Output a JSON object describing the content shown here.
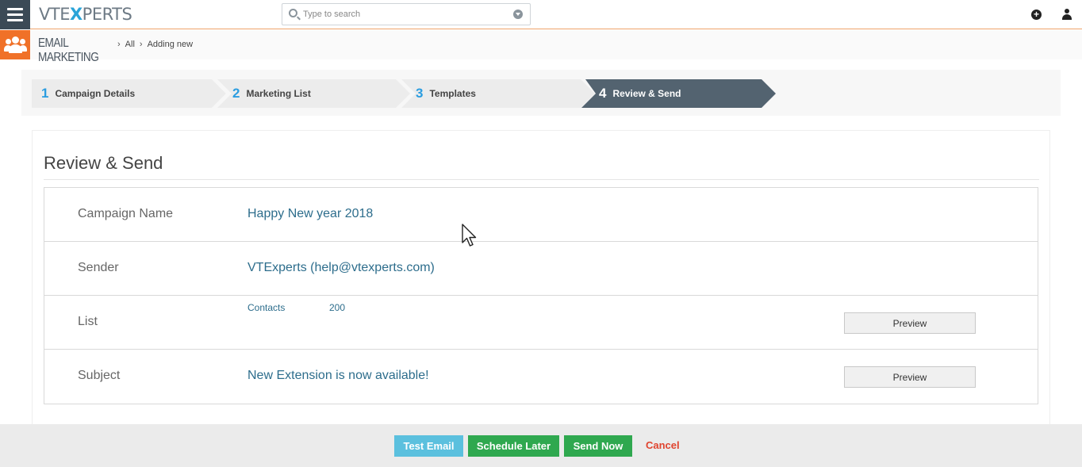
{
  "header": {
    "logo_prefix": "VTE",
    "logo_x": "X",
    "logo_suffix": "PERTS",
    "search_placeholder": "Type to search"
  },
  "breadcrumb": {
    "module": "EMAIL MARKETING",
    "items": [
      "All",
      "Adding new"
    ]
  },
  "steps": [
    {
      "num": "1",
      "label": "Campaign Details",
      "active": false
    },
    {
      "num": "2",
      "label": "Marketing List",
      "active": false
    },
    {
      "num": "3",
      "label": "Templates",
      "active": false
    },
    {
      "num": "4",
      "label": "Review & Send",
      "active": true
    }
  ],
  "review": {
    "title": "Review & Send",
    "campaign_name_label": "Campaign Name",
    "campaign_name_value": "Happy New year 2018",
    "sender_label": "Sender",
    "sender_value": "VTExperts (help@vtexperts.com)",
    "list_label": "List",
    "list_name": "Contacts",
    "list_count": "200",
    "list_preview": "Preview",
    "subject_label": "Subject",
    "subject_value": "New Extension is now available!",
    "subject_preview": "Preview"
  },
  "footer": {
    "test_email": "Test Email",
    "schedule_later": "Schedule Later",
    "send_now": "Send Now",
    "cancel": "Cancel"
  },
  "colors": {
    "accent_orange": "#f07128",
    "step_active": "#536370",
    "step_number": "#2b9de0",
    "btn_info": "#5bc0de",
    "btn_success": "#2fa84f",
    "cancel_red": "#e0442f"
  }
}
